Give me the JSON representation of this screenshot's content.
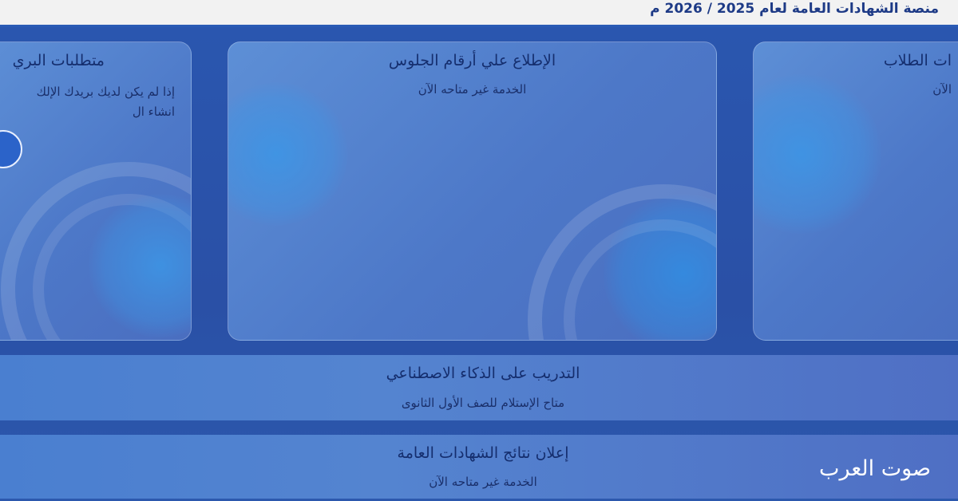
{
  "header": {
    "title": "منصة الشهادات العامة لعام 2025 / 2026 م"
  },
  "cards": {
    "left": {
      "title": "متطلبات البري",
      "line1": "إذا لم يكن لديك بريدك الإلك",
      "line2": "انشاء ال"
    },
    "center": {
      "title": "الإطلاع علي أرقام الجلوس",
      "subtitle": "الخدمة غير متاحه الآن"
    },
    "right": {
      "title": "ات الطلاب",
      "subtitle": "الآن"
    }
  },
  "bands": {
    "ai_training": {
      "title": "التدريب على الذكاء الاصطناعي",
      "subtitle": "متاح الإستلام للصف الأول الثانوى"
    },
    "results": {
      "title": "إعلان نتائج الشهادات العامة",
      "subtitle": "الخدمة غير متاحه الآن"
    }
  },
  "watermark": "صوت العرب"
}
